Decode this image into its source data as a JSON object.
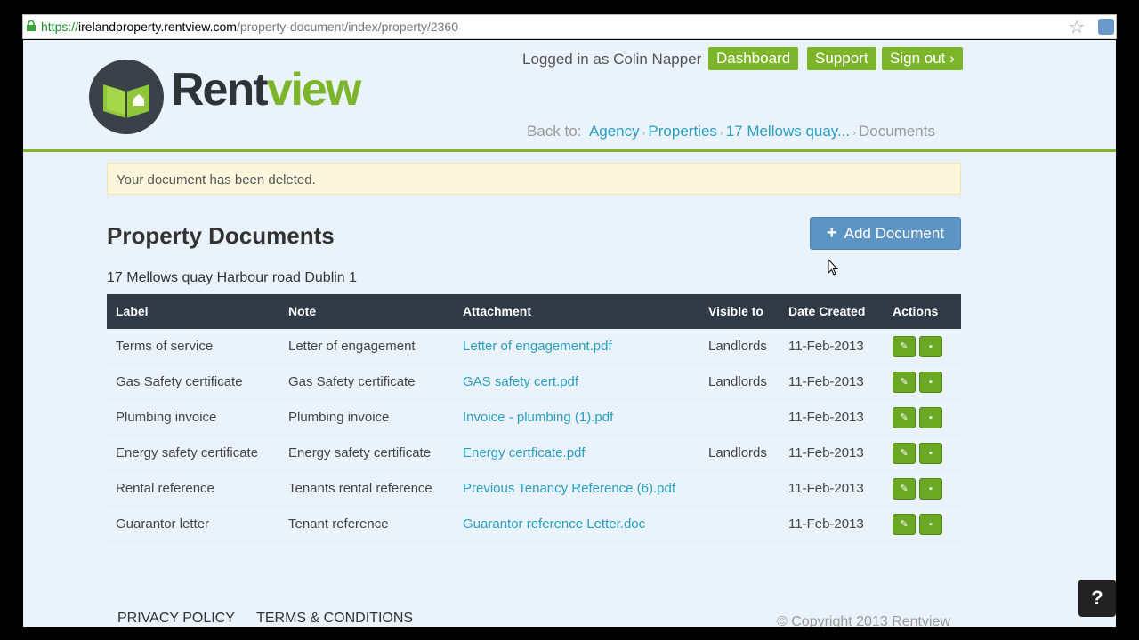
{
  "browser": {
    "url_scheme": "https://",
    "url_host": "irelandproperty.rentview.com",
    "url_path": "/property-document/index/property/2360"
  },
  "header": {
    "logo_rent": "Rent",
    "logo_view": "view",
    "logged_in": "Logged in as Colin Napper",
    "nav": {
      "dashboard": "Dashboard",
      "support": "Support",
      "signout": "Sign out ›"
    },
    "breadcrumb": {
      "back_to": "Back to:",
      "agency": "Agency",
      "properties": "Properties",
      "property": "17 Mellows quay...",
      "current": "Documents"
    }
  },
  "alert": "Your document has been deleted.",
  "main": {
    "title": "Property Documents",
    "add_button": "Add Document",
    "address": "17 Mellows quay Harbour road Dublin 1"
  },
  "table": {
    "headers": [
      "Label",
      "Note",
      "Attachment",
      "Visible to",
      "Date Created",
      "Actions"
    ],
    "rows": [
      {
        "label": "Terms of service",
        "note": "Letter of engagement",
        "attachment": "Letter of engagement.pdf",
        "visible": "Landlords",
        "date": "11-Feb-2013"
      },
      {
        "label": "Gas Safety certificate",
        "note": "Gas Safety certificate",
        "attachment": "GAS safety cert.pdf",
        "visible": "Landlords",
        "date": "11-Feb-2013"
      },
      {
        "label": "Plumbing invoice",
        "note": "Plumbing invoice",
        "attachment": "Invoice - plumbing (1).pdf",
        "visible": "",
        "date": "11-Feb-2013"
      },
      {
        "label": "Energy safety certificate",
        "note": "Energy safety certificate",
        "attachment": "Energy certficate.pdf",
        "visible": "Landlords",
        "date": "11-Feb-2013"
      },
      {
        "label": "Rental reference",
        "note": "Tenants rental reference",
        "attachment": "Previous Tenancy Reference (6).pdf",
        "visible": "",
        "date": "11-Feb-2013"
      },
      {
        "label": "Guarantor letter",
        "note": "Tenant reference",
        "attachment": "Guarantor reference Letter.doc",
        "visible": "",
        "date": "11-Feb-2013"
      }
    ]
  },
  "footer": {
    "privacy": "PRIVACY POLICY",
    "terms": "TERMS & CONDITIONS",
    "copyright": "© Copyright 2013 Rentview"
  },
  "help_label": "?",
  "colors": {
    "accent_green": "#7db52a",
    "link_blue": "#2a9fc1",
    "header_dark": "#2f3a45",
    "page_bg": "#eaf3fb"
  }
}
